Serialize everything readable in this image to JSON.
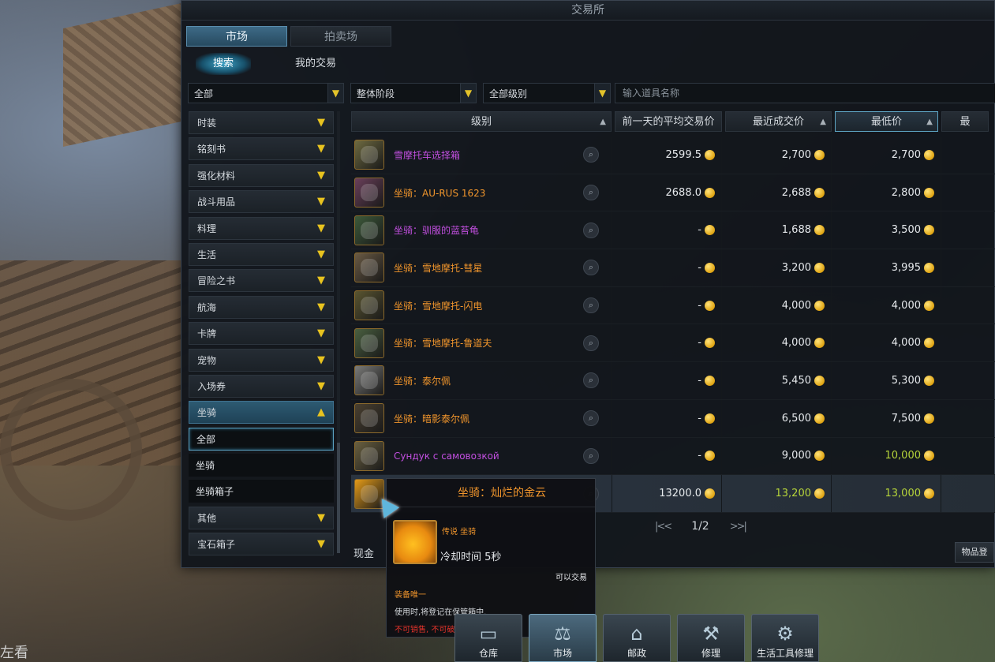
{
  "window": {
    "title": "交易所"
  },
  "tabs": [
    {
      "label": "市场",
      "active": true
    },
    {
      "label": "拍卖场",
      "active": false
    }
  ],
  "subtabs": [
    {
      "label": "搜索",
      "active": true
    },
    {
      "label": "我的交易",
      "active": false
    }
  ],
  "filters": {
    "category": "全部",
    "stage": "整体阶段",
    "level": "全部级别",
    "search_placeholder": "输入道具名称"
  },
  "categories": [
    {
      "label": "时装"
    },
    {
      "label": "铭刻书"
    },
    {
      "label": "强化材料"
    },
    {
      "label": "战斗用品"
    },
    {
      "label": "料理"
    },
    {
      "label": "生活"
    },
    {
      "label": "冒险之书"
    },
    {
      "label": "航海"
    },
    {
      "label": "卡牌"
    },
    {
      "label": "宠物"
    },
    {
      "label": "入场券"
    },
    {
      "label": "坐骑",
      "open": true,
      "children": [
        {
          "label": "全部",
          "selected": true
        },
        {
          "label": "坐骑"
        },
        {
          "label": "坐骑箱子"
        }
      ]
    },
    {
      "label": "其他"
    },
    {
      "label": "宝石箱子"
    }
  ],
  "table": {
    "headers": {
      "grade": "级别",
      "avg_price": "前一天的平均交易价",
      "recent_price": "最近成交价",
      "lowest_price": "最低价",
      "last": "最"
    },
    "rows": [
      {
        "name": "雪摩托车选择箱",
        "color": "purple",
        "icon_color": "#6e6a40",
        "avg": "2599.5",
        "recent": "2,700",
        "lowest": "2,700"
      },
      {
        "name": "坐骑：AU-RUS 1623",
        "color": "orange",
        "icon_color": "#6a3f5a",
        "avg": "2688.0",
        "recent": "2,688",
        "lowest": "2,800"
      },
      {
        "name": "坐骑：驯服的蓝苔龟",
        "color": "purple",
        "icon_color": "#3d5a3a",
        "avg": "-",
        "recent": "1,688",
        "lowest": "3,500"
      },
      {
        "name": "坐骑：雪地摩托-彗星",
        "color": "orange",
        "icon_color": "#6a5a44",
        "avg": "-",
        "recent": "3,200",
        "lowest": "3,995"
      },
      {
        "name": "坐骑：雪地摩托-闪电",
        "color": "orange",
        "icon_color": "#5a5530",
        "avg": "-",
        "recent": "4,000",
        "lowest": "4,000"
      },
      {
        "name": "坐骑：雪地摩托-鲁道夫",
        "color": "orange",
        "icon_color": "#4a6040",
        "avg": "-",
        "recent": "4,000",
        "lowest": "4,000"
      },
      {
        "name": "坐骑：泰尔佩",
        "color": "orange",
        "icon_color": "#7a7a78",
        "avg": "-",
        "recent": "5,450",
        "lowest": "5,300"
      },
      {
        "name": "坐骑：暗影泰尔佩",
        "color": "orange",
        "icon_color": "#4a4030",
        "avg": "-",
        "recent": "6,500",
        "lowest": "7,500"
      },
      {
        "name": "Сундук с самовозкой",
        "color": "purple",
        "icon_color": "#6a6040",
        "avg": "-",
        "recent": "9,000",
        "lowest": "10,000",
        "lowest_green": true
      },
      {
        "name": "",
        "color": "orange",
        "icon_color": "#e39a18",
        "avg": "13200.0",
        "recent": "13,200",
        "lowest": "13,000",
        "recent_green": true,
        "lowest_green": true,
        "highlight": true
      }
    ]
  },
  "pager": {
    "first": "|<",
    "prev": "<",
    "page": "1/2",
    "next": ">",
    "last": ">|"
  },
  "cash_label": "现金",
  "item_register_button": "物品登",
  "tooltip": {
    "title": "坐骑：灿烂的金云",
    "grade": "传说 坐骑",
    "cooldown": "冷却时间 5秒",
    "tradable": "可以交易",
    "unique": "装备唯一",
    "description": "使用时,将登记在保管箱中.",
    "restrictions": "不可销售, 不可破坏, 无法分解"
  },
  "dock": [
    {
      "label": "仓库",
      "icon": "warehouse-icon",
      "glyph": "▭"
    },
    {
      "label": "市场",
      "icon": "market-icon",
      "glyph": "⚖",
      "active": true
    },
    {
      "label": "邮政",
      "icon": "mail-icon",
      "glyph": "⌂"
    },
    {
      "label": "修理",
      "icon": "anvil-icon",
      "glyph": "⚒"
    },
    {
      "label": "生活工具修理",
      "icon": "tool-repair-icon",
      "glyph": "⚙"
    }
  ],
  "corner_text": "左看"
}
